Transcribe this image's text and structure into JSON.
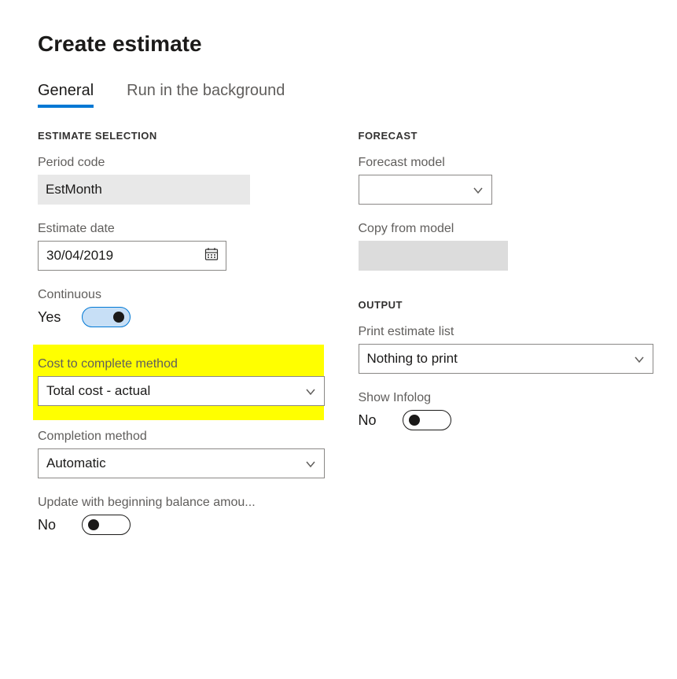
{
  "title": "Create estimate",
  "tabs": {
    "general": "General",
    "background": "Run in the background",
    "active": "general"
  },
  "left": {
    "section1_header": "ESTIMATE SELECTION",
    "period_code": {
      "label": "Period code",
      "value": "EstMonth"
    },
    "estimate_date": {
      "label": "Estimate date",
      "value": "30/04/2019"
    },
    "continuous": {
      "label": "Continuous",
      "state_text": "Yes",
      "on": true
    },
    "cost_method": {
      "label": "Cost to complete method",
      "value": "Total cost - actual"
    },
    "completion_method": {
      "label": "Completion method",
      "value": "Automatic"
    },
    "update_balance": {
      "label": "Update with beginning balance amou...",
      "state_text": "No",
      "on": false
    }
  },
  "right": {
    "section1_header": "FORECAST",
    "forecast_model": {
      "label": "Forecast model",
      "value": ""
    },
    "copy_from_model": {
      "label": "Copy from model",
      "value": ""
    },
    "section2_header": "OUTPUT",
    "print_list": {
      "label": "Print estimate list",
      "value": "Nothing to print"
    },
    "show_infolog": {
      "label": "Show Infolog",
      "state_text": "No",
      "on": false
    }
  }
}
